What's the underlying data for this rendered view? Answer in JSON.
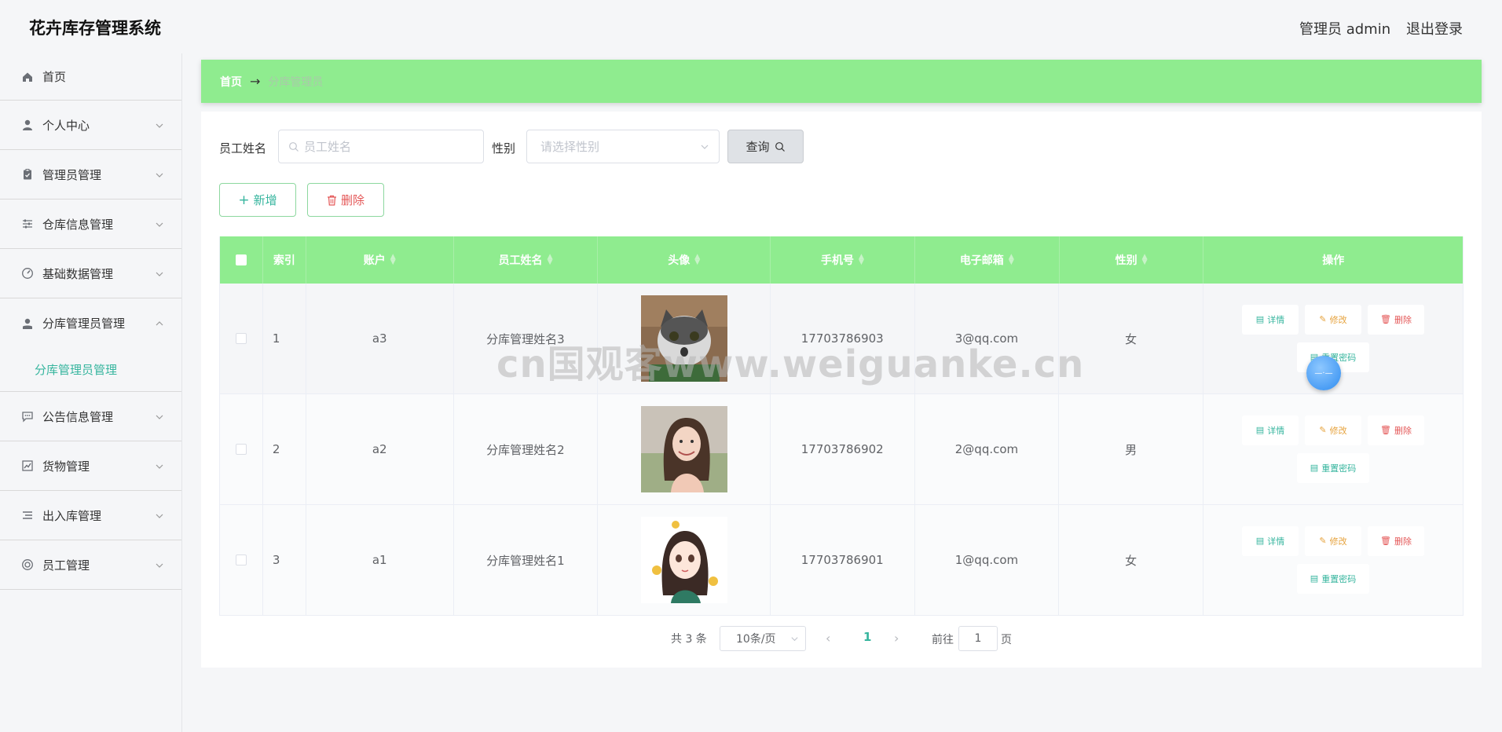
{
  "app": {
    "title": "花卉库存管理系统"
  },
  "header": {
    "admin_label": "管理员 admin",
    "logout_label": "退出登录"
  },
  "sidebar": {
    "items": [
      {
        "label": "首页",
        "icon": "home-icon"
      },
      {
        "label": "个人中心",
        "icon": "user-icon"
      },
      {
        "label": "管理员管理",
        "icon": "clipboard-icon"
      },
      {
        "label": "仓库信息管理",
        "icon": "sliders-icon"
      },
      {
        "label": "基础数据管理",
        "icon": "gauge-icon"
      },
      {
        "label": "分库管理员管理",
        "icon": "user-solid-icon"
      },
      {
        "label": "公告信息管理",
        "icon": "chat-icon"
      },
      {
        "label": "货物管理",
        "icon": "chart-icon"
      },
      {
        "label": "出入库管理",
        "icon": "list-icon"
      },
      {
        "label": "员工管理",
        "icon": "help-ring-icon"
      }
    ],
    "active_submenu": "分库管理员管理"
  },
  "breadcrumb": {
    "home": "首页",
    "separator": "→",
    "current": "分库管理员"
  },
  "filters": {
    "name_label": "员工姓名",
    "name_placeholder": "员工姓名",
    "gender_label": "性别",
    "gender_placeholder": "请选择性别",
    "query_label": "查询"
  },
  "actions": {
    "add_label": "新增",
    "delete_label": "删除"
  },
  "table": {
    "columns": [
      "索引",
      "账户",
      "员工姓名",
      "头像",
      "手机号",
      "电子邮箱",
      "性别",
      "操作"
    ],
    "rows": [
      {
        "index": "1",
        "account": "a3",
        "name": "分库管理姓名3",
        "avatar": "cat-photo",
        "phone": "17703786903",
        "email": "3@qq.com",
        "gender": "女"
      },
      {
        "index": "2",
        "account": "a2",
        "name": "分库管理姓名2",
        "avatar": "girl-photo",
        "phone": "17703786902",
        "email": "2@qq.com",
        "gender": "男"
      },
      {
        "index": "3",
        "account": "a1",
        "name": "分库管理姓名1",
        "avatar": "cartoon-girl",
        "phone": "17703786901",
        "email": "1@qq.com",
        "gender": "女"
      }
    ],
    "row_actions": {
      "detail": "详情",
      "edit": "修改",
      "delete": "删除",
      "reset": "重置密码"
    }
  },
  "pagination": {
    "total": "共 3 条",
    "page_size": "10条/页",
    "current_page": "1",
    "goto_label": "前往",
    "goto_value": "1",
    "page_suffix": "页"
  },
  "watermark": "cn国观客www.weiguanke.cn",
  "colors": {
    "accent_green": "#8fec8f",
    "teal": "#36b59e",
    "danger": "#e45757",
    "warning": "#e6a23c"
  }
}
